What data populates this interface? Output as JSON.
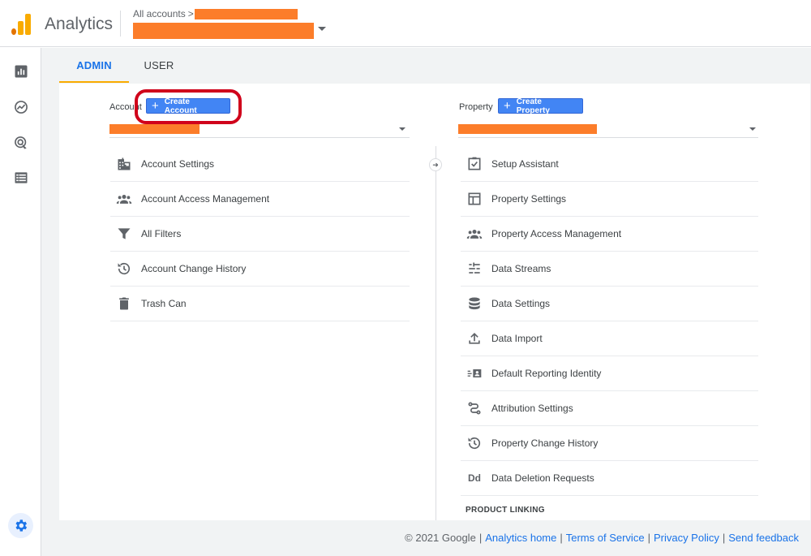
{
  "header": {
    "app_title": "Analytics",
    "breadcrumb_root": "All accounts",
    "breadcrumb_chevron": ">"
  },
  "tabs": [
    {
      "label": "ADMIN",
      "active": true
    },
    {
      "label": "USER",
      "active": false
    }
  ],
  "account_column": {
    "label": "Account",
    "create_button": "Create Account",
    "items": [
      {
        "label": "Account Settings",
        "icon": "building-icon"
      },
      {
        "label": "Account Access Management",
        "icon": "people-icon"
      },
      {
        "label": "All Filters",
        "icon": "filter-icon"
      },
      {
        "label": "Account Change History",
        "icon": "history-icon"
      },
      {
        "label": "Trash Can",
        "icon": "trash-icon"
      }
    ]
  },
  "property_column": {
    "label": "Property",
    "create_button": "Create Property",
    "items": [
      {
        "label": "Setup Assistant",
        "icon": "checkbox-icon"
      },
      {
        "label": "Property Settings",
        "icon": "layout-icon"
      },
      {
        "label": "Property Access Management",
        "icon": "people-icon"
      },
      {
        "label": "Data Streams",
        "icon": "streams-icon"
      },
      {
        "label": "Data Settings",
        "icon": "database-icon"
      },
      {
        "label": "Data Import",
        "icon": "upload-icon"
      },
      {
        "label": "Default Reporting Identity",
        "icon": "identity-icon"
      },
      {
        "label": "Attribution Settings",
        "icon": "attribution-icon"
      },
      {
        "label": "Property Change History",
        "icon": "history-icon"
      },
      {
        "label": "Data Deletion Requests",
        "icon": "dd-icon",
        "glyph": "Dd"
      }
    ],
    "section_heading": "PRODUCT LINKING"
  },
  "footer": {
    "copyright": "© 2021 Google",
    "links": [
      "Analytics home",
      "Terms of Service",
      "Privacy Policy",
      "Send feedback"
    ],
    "separator": "|"
  },
  "colors": {
    "accent": "#1a73e8",
    "button": "#4285f4",
    "tab_indicator": "#f9ab00",
    "redaction": "#fc7d2a",
    "highlight": "#d0021b"
  }
}
